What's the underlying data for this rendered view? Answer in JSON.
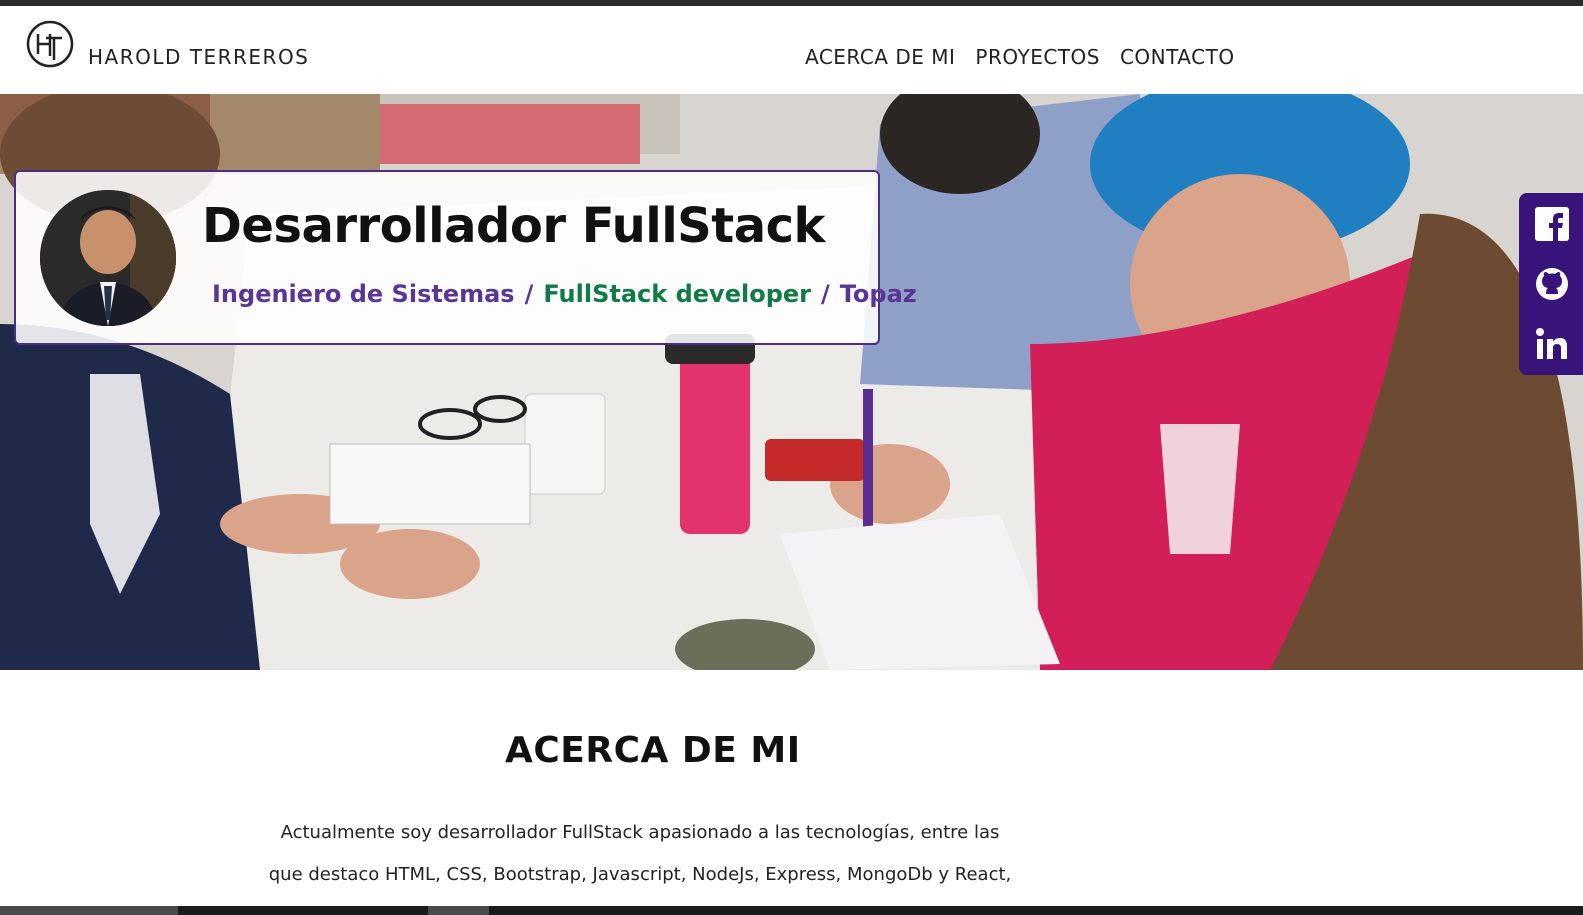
{
  "header": {
    "brand": "HAROLD TERREROS",
    "logo_monogram": "HT",
    "nav": [
      "ACERCA DE MI",
      "PROYECTOS",
      "CONTACTO"
    ]
  },
  "hero": {
    "title": "Desarrollador FullStack",
    "subtitle_parts": [
      "Ingeniero de Sistemas",
      "/",
      "FullStack developer",
      "/",
      "Topaz"
    ]
  },
  "social": [
    "facebook-icon",
    "github-icon",
    "linkedin-icon"
  ],
  "about": {
    "title": "ACERCA DE MI",
    "line1": "Actualmente soy desarrollador FullStack apasionado a las tecnologías, entre las",
    "line2": "que destaco HTML, CSS, Bootstrap, Javascript, NodeJs, Express, MongoDb y React,"
  },
  "colors": {
    "accent": "#4b2e83",
    "social_bg": "#37137a",
    "subtitle_green": "#0f7b45",
    "subtitle_purple": "#5a3596"
  }
}
